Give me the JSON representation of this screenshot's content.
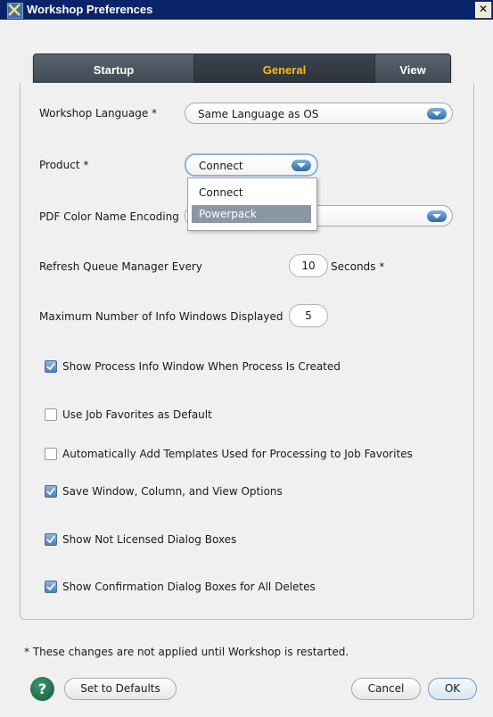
{
  "window": {
    "title": "Workshop Preferences",
    "close_label": "✕"
  },
  "tabs": [
    {
      "label": "Startup",
      "active": false
    },
    {
      "label": "General",
      "active": true
    },
    {
      "label": "View",
      "active": false
    }
  ],
  "fields": {
    "workshop_language": {
      "label": "Workshop Language *",
      "value": "Same Language as OS"
    },
    "product": {
      "label": "Product *",
      "value": "Connect",
      "options": [
        "Connect",
        "Powerpack"
      ],
      "highlighted": "Powerpack"
    },
    "pdf_color": {
      "label": "PDF Color Name Encoding"
    },
    "refresh": {
      "label": "Refresh Queue Manager Every",
      "value": "10",
      "suffix": "Seconds *"
    },
    "max_info": {
      "label": "Maximum Number of Info Windows Displayed",
      "value": "5"
    }
  },
  "checkboxes": [
    {
      "label": "Show Process Info Window When Process Is Created",
      "checked": true
    },
    {
      "label": "Use Job Favorites as Default",
      "checked": false
    },
    {
      "label": "Automatically Add Templates Used for Processing to Job Favorites",
      "checked": false
    },
    {
      "label": "Save Window, Column, and View Options",
      "checked": true
    },
    {
      "label": "Show Not Licensed Dialog Boxes",
      "checked": true
    },
    {
      "label": "Show Confirmation Dialog Boxes for All Deletes",
      "checked": true
    }
  ],
  "footer": {
    "note": "* These changes are not applied until Workshop is restarted.",
    "help_label": "?",
    "defaults_label": "Set to Defaults",
    "cancel_label": "Cancel",
    "ok_label": "OK"
  },
  "colors": {
    "title_bar": "#0a246a",
    "active_tab_text": "#ffb818",
    "tab_bar": "#4a545e",
    "check_fill": "#4f81b8"
  }
}
